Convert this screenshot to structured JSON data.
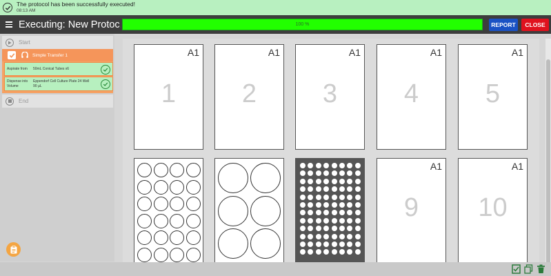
{
  "notification": {
    "message": "The protocol has been successfully executed!",
    "time": "08:13 AM",
    "icon": "check-circle-icon"
  },
  "header": {
    "title": "Executing: New Protoc...",
    "progress_label": "100 %",
    "progress_value": 100,
    "report_label": "REPORT",
    "close_label": "CLOSE",
    "colors": {
      "report": "#1a52c4",
      "close": "#e0121e",
      "progress": "#22ff00"
    }
  },
  "sidebar": {
    "start_label": "Start",
    "end_label": "End",
    "transfer": {
      "title": "Simple Transfer 1",
      "aspirate_key": "Aspirate from",
      "aspirate_value": "50mL Conical Tubes x6",
      "dispense_key_1": "Dispense into",
      "dispense_key_2": "Volume",
      "dispense_value_1": "Eppendorf Cell Culture Plate 24 Well",
      "dispense_value_2": "90 µL"
    }
  },
  "deck": {
    "slots": [
      {
        "position": "A1",
        "number": "1"
      },
      {
        "position": "A1",
        "number": "2"
      },
      {
        "position": "A1",
        "number": "3"
      },
      {
        "position": "A1",
        "number": "4"
      },
      {
        "position": "A1",
        "number": "5"
      },
      {
        "position": "A1",
        "number": "9"
      },
      {
        "position": "A1",
        "number": "10"
      }
    ],
    "plates": [
      {
        "type": "24-well",
        "cols": 4,
        "rows": 6
      },
      {
        "type": "6-well",
        "cols": 2,
        "rows": 3
      },
      {
        "type": "96-well",
        "cols": 8,
        "rows": 12
      }
    ]
  }
}
